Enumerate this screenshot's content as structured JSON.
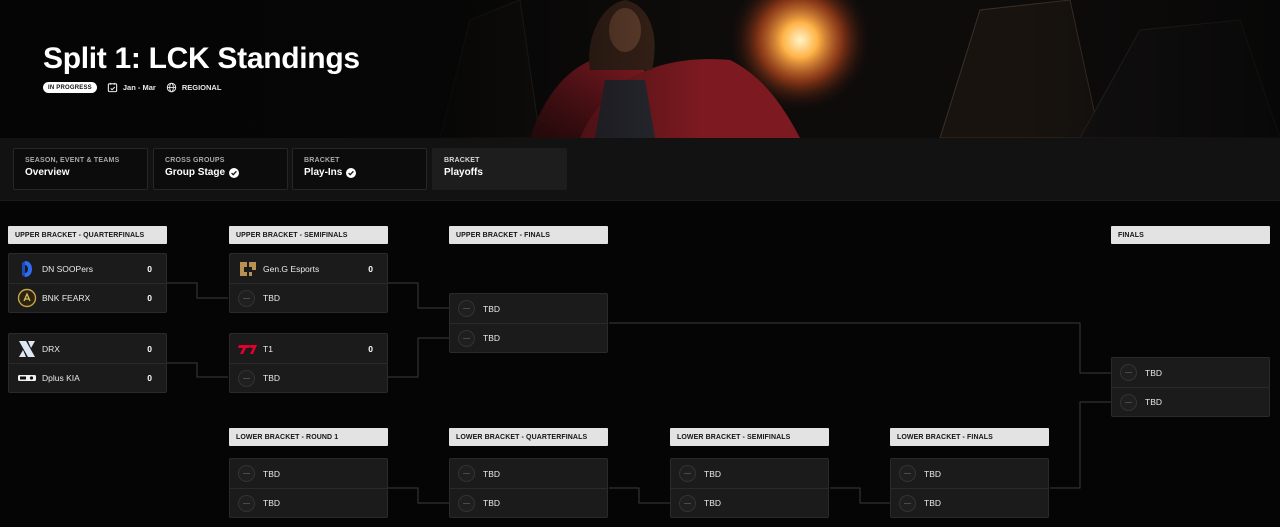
{
  "hero": {
    "title": "Split 1: LCK Standings",
    "status_badge": "IN PROGRESS",
    "date_range": "Jan - Mar",
    "region": "REGIONAL"
  },
  "tabs": [
    {
      "small": "SEASON, EVENT & TEAMS",
      "main": "Overview",
      "checked": false,
      "active": false
    },
    {
      "small": "CROSS GROUPS",
      "main": "Group Stage",
      "checked": true,
      "active": false
    },
    {
      "small": "BRACKET",
      "main": "Play-Ins",
      "checked": true,
      "active": false
    },
    {
      "small": "BRACKET",
      "main": "Playoffs",
      "checked": false,
      "active": true
    }
  ],
  "bracket": {
    "rounds": {
      "ub_quarterfinals": "UPPER BRACKET - QUARTERFINALS",
      "ub_semifinals": "UPPER BRACKET - SEMIFINALS",
      "ub_finals": "UPPER BRACKET - FINALS",
      "finals": "FINALS",
      "lb_round1": "LOWER BRACKET - ROUND 1",
      "lb_quarterfinals": "LOWER BRACKET - QUARTERFINALS",
      "lb_semifinals": "LOWER BRACKET - SEMIFINALS",
      "lb_finals": "LOWER BRACKET - FINALS"
    },
    "matches": {
      "ubqf1": [
        {
          "name": "DN SOOPers",
          "score": "0",
          "logo": "dn-soopers-logo"
        },
        {
          "name": "BNK FEARX",
          "score": "0",
          "logo": "bnk-fearx-logo"
        }
      ],
      "ubqf2": [
        {
          "name": "DRX",
          "score": "0",
          "logo": "drx-logo"
        },
        {
          "name": "Dplus KIA",
          "score": "0",
          "logo": "dplus-kia-logo"
        }
      ],
      "ubsf1": [
        {
          "name": "Gen.G Esports",
          "score": "0",
          "logo": "geng-logo"
        },
        {
          "name": "TBD",
          "score": ""
        }
      ],
      "ubsf2": [
        {
          "name": "T1",
          "score": "0",
          "logo": "t1-logo"
        },
        {
          "name": "TBD",
          "score": ""
        }
      ],
      "ubf": [
        {
          "name": "TBD"
        },
        {
          "name": "TBD"
        }
      ],
      "finals": [
        {
          "name": "TBD"
        },
        {
          "name": "TBD"
        }
      ],
      "lbr1": [
        {
          "name": "TBD"
        },
        {
          "name": "TBD"
        }
      ],
      "lbqf": [
        {
          "name": "TBD"
        },
        {
          "name": "TBD"
        }
      ],
      "lbsf": [
        {
          "name": "TBD"
        },
        {
          "name": "TBD"
        }
      ],
      "lbf": [
        {
          "name": "TBD"
        },
        {
          "name": "TBD"
        }
      ]
    }
  }
}
